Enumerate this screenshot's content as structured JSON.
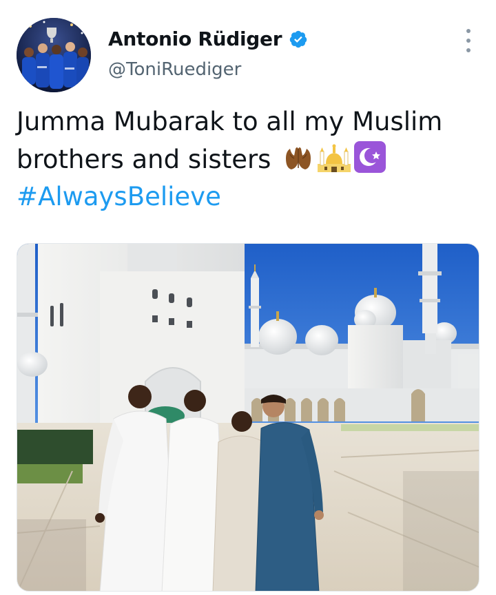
{
  "tweet": {
    "author": {
      "display_name": "Antonio Rüdiger",
      "handle": "@ToniRuediger",
      "verified": true,
      "avatar_icon": "profile-photo-team-celebration"
    },
    "text": {
      "line1": "Jumma Mubarak to all my Muslim",
      "line2": "brothers and sisters",
      "emojis": [
        "palms-up-together-emoji",
        "mosque-emoji",
        "star-and-crescent-emoji"
      ],
      "hashtag": "#AlwaysBelieve"
    },
    "media": {
      "type": "photo",
      "subject": "four-men-in-white-and-blue-robes-in-front-of-white-mosque"
    },
    "menu_icon": "more-options-icon"
  },
  "colors": {
    "text_primary": "#0f1419",
    "text_secondary": "#536471",
    "link": "#1d9bf0",
    "verified": "#1d9bf0",
    "sky": "#1e63c9"
  }
}
